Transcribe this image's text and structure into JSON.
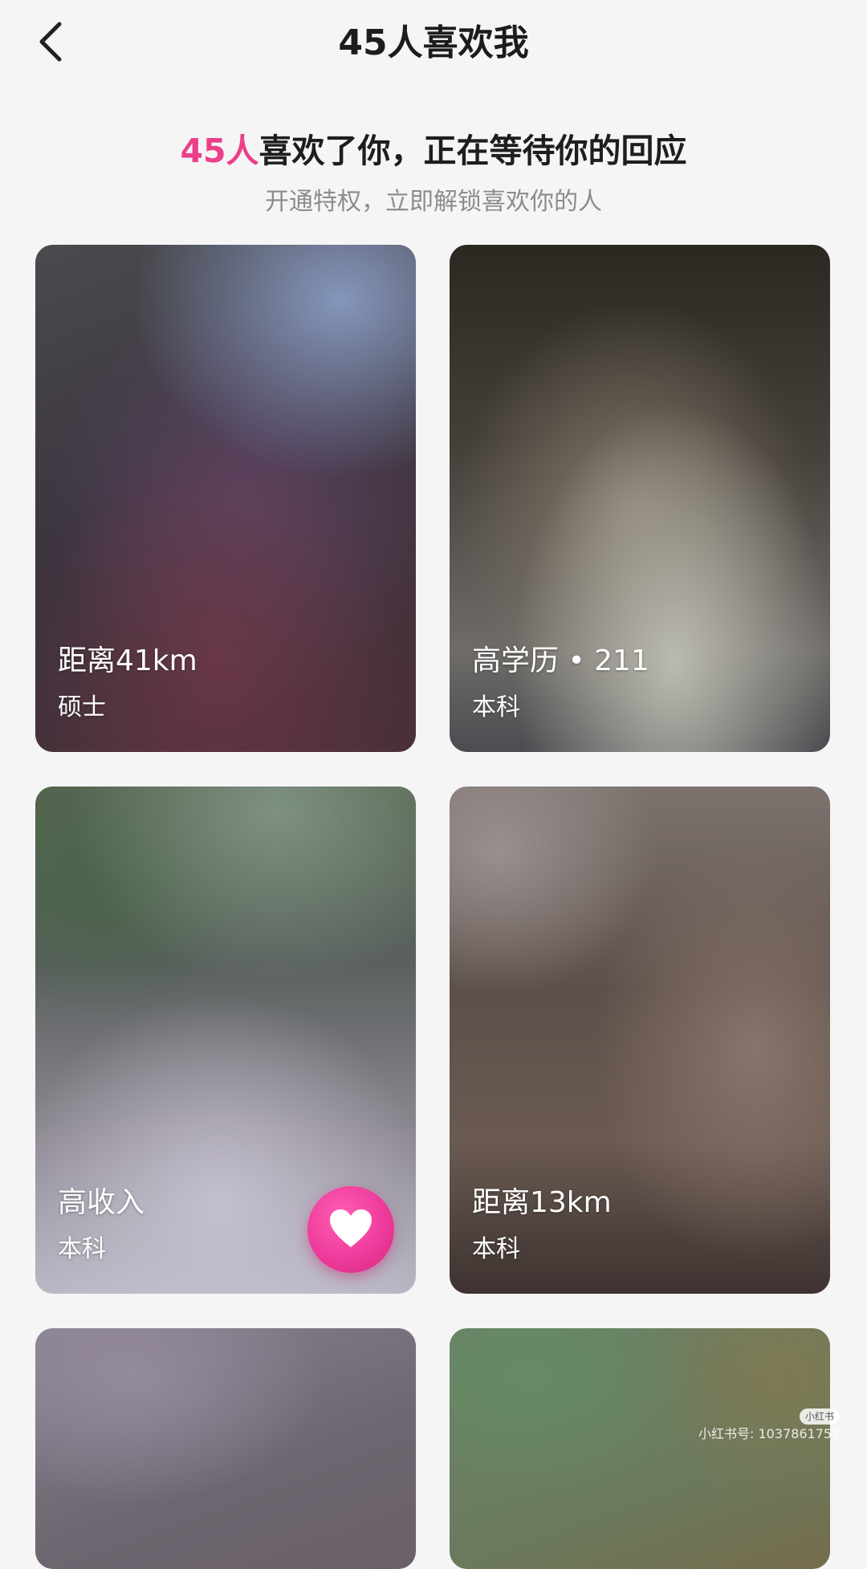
{
  "header": {
    "title": "45人喜欢我",
    "back_icon": "chevron-left-icon"
  },
  "intro": {
    "count": "45人",
    "headline_rest": "喜欢了你，正在等待你的回应",
    "subline": "开通特权，立即解锁喜欢你的人",
    "accent_color": "#ec3f8a"
  },
  "cards": [
    {
      "line1": "距离41km",
      "line2": "硕士"
    },
    {
      "line1": "高学历 • 211",
      "line2": "本科"
    },
    {
      "line1": "高收入",
      "line2": "本科"
    },
    {
      "line1": "距离13km",
      "line2": "本科"
    },
    {
      "line1": "",
      "line2": ""
    },
    {
      "line1": "",
      "line2": ""
    }
  ],
  "like_button": {
    "icon": "heart-icon",
    "color": "#ee3b9c"
  },
  "watermark": {
    "logo_text": "小红书",
    "text": "小红书号: 1037861753"
  }
}
